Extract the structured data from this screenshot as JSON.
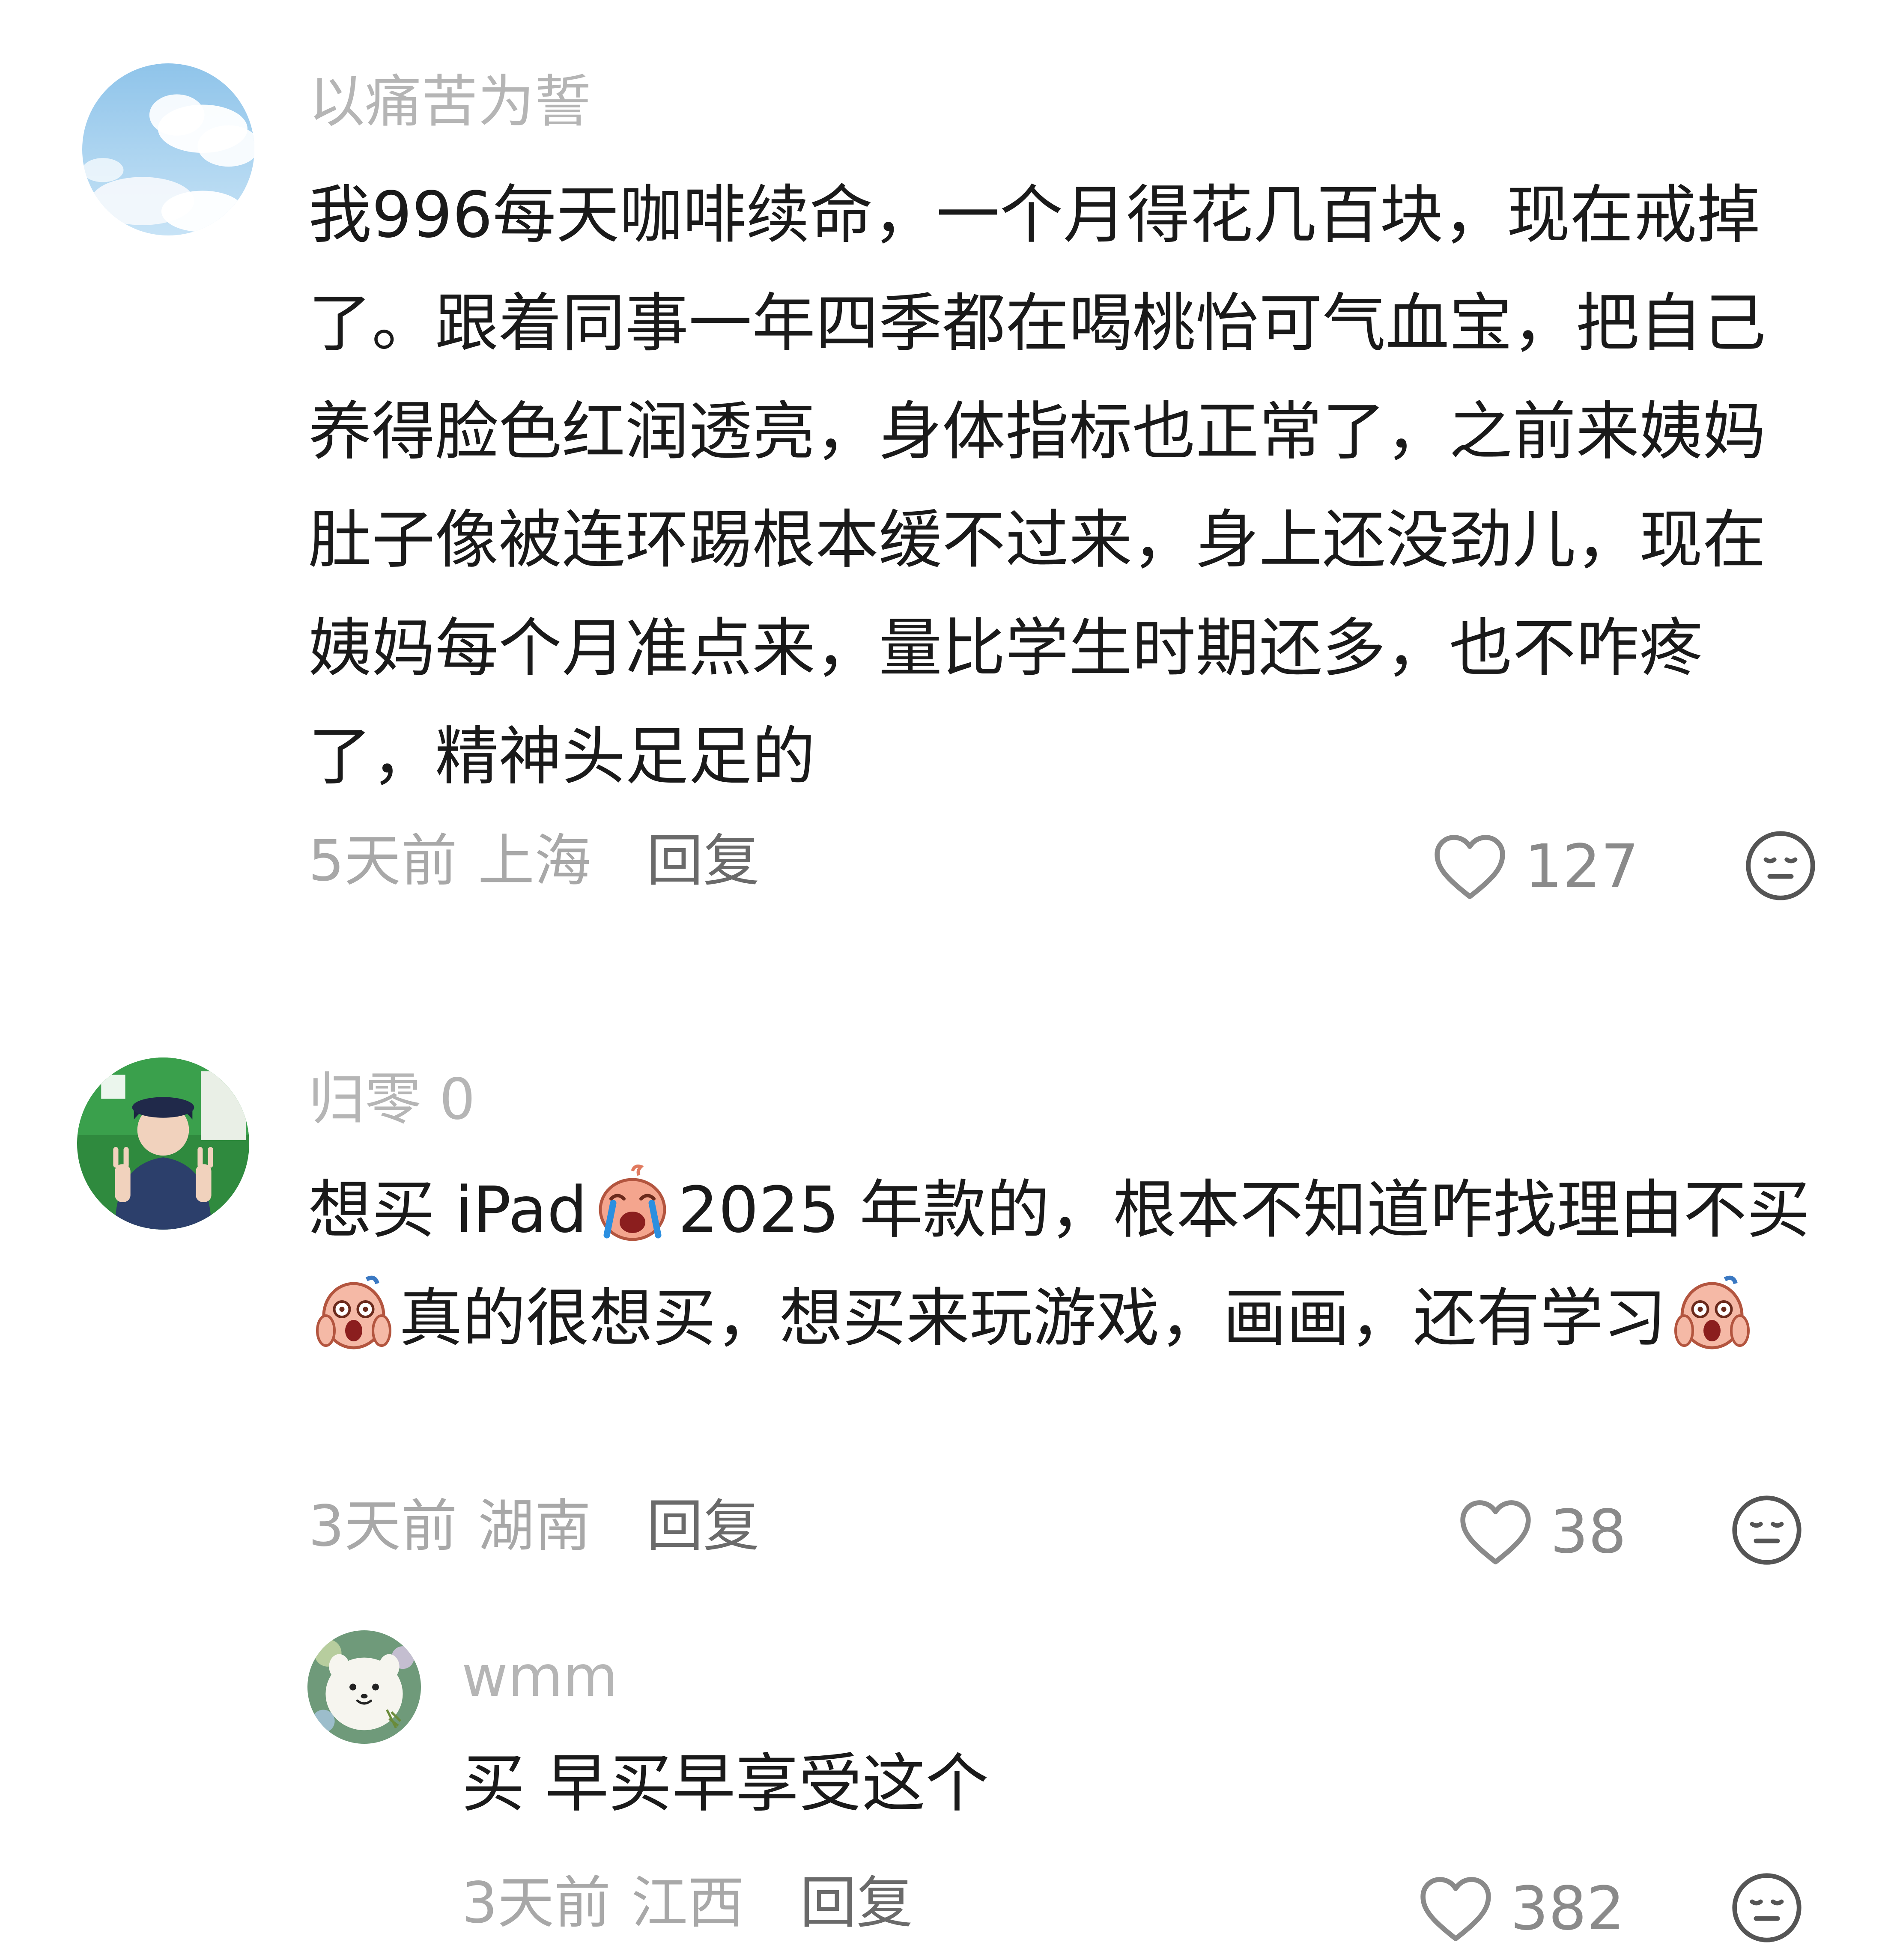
{
  "comments": [
    {
      "username": "以痛苦为誓",
      "text": "我996每天咖啡续命，一个月得花几百块，现在戒掉了。跟着同事一年四季都在喝桃怡可气血宝，把自己养得脸色红润透亮，身体指标也正常了，之前来姨妈肚子像被连环踢根本缓不过来，身上还没劲儿，现在姨妈每个月准点来，量比学生时期还多，也不咋疼了，精神头足足的",
      "time": "5天前",
      "location": "上海",
      "reply_label": "回复",
      "likes": "127",
      "avatar_icon": "sky-cloud-avatar",
      "replies": [],
      "colors": {
        "username": "#b5b5b5",
        "text": "#1a1a1a",
        "meta": "#a8a8a8"
      }
    },
    {
      "username": "归零 0",
      "text_parts": [
        "想买 iPad",
        "2025 年款的，根本不知道咋找理由不买",
        "真的很想买，想买来玩游戏，画画，还有学习"
      ],
      "emojis": [
        "crying-face-emoji",
        "screaming-face-emoji",
        "screaming-face-emoji"
      ],
      "time": "3天前",
      "location": "湖南",
      "reply_label": "回复",
      "likes": "38",
      "avatar_icon": "person-peace-sign-avatar",
      "replies": [
        {
          "username": "wmm",
          "text": "买 早买早享受这个",
          "time": "3天前",
          "location": "江西",
          "reply_label": "回复",
          "likes": "382",
          "avatar_icon": "white-dog-avatar"
        }
      ]
    }
  ],
  "icons": {
    "like": "heart-outline-icon",
    "dislike": "neutral-face-icon"
  }
}
